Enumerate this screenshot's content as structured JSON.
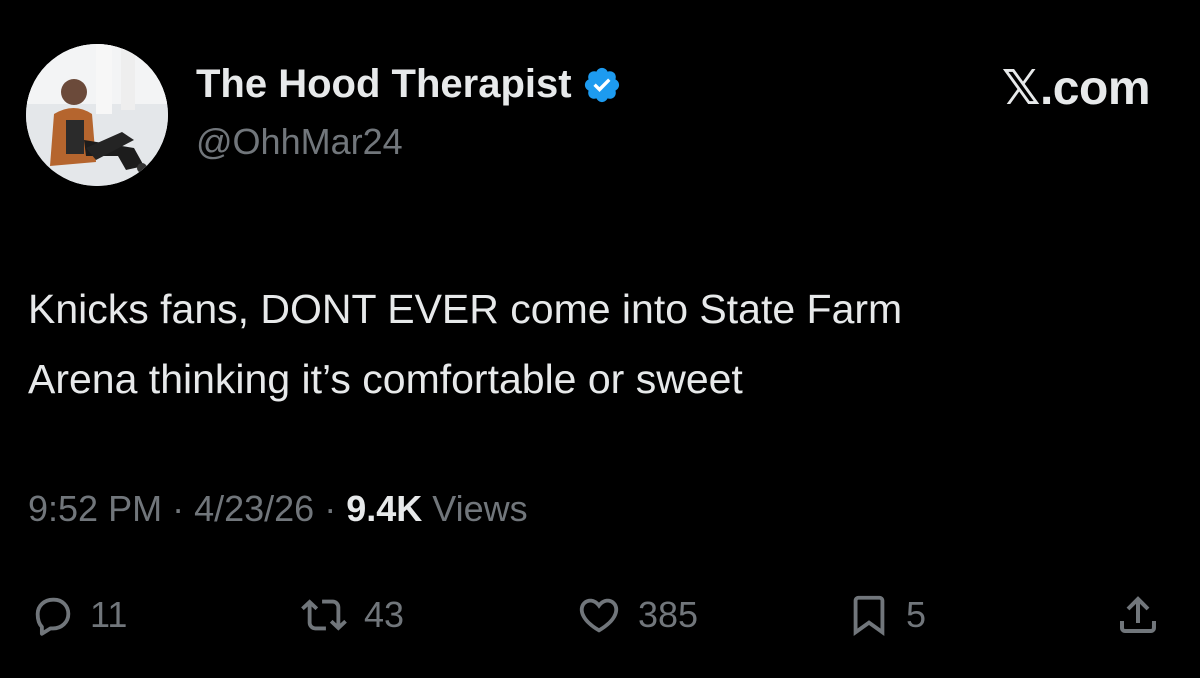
{
  "author": {
    "display_name": "The Hood Therapist",
    "handle": "@OhhMar24",
    "verified": true,
    "verified_color": "#1d9bf0"
  },
  "brand": {
    "label": "𝕏.com"
  },
  "tweet": {
    "text_line1": "Knicks fans, DONT EVER come into State Farm",
    "text_line2": "Arena thinking it’s comfortable or sweet"
  },
  "meta": {
    "time": "9:52 PM",
    "separator": " · ",
    "date": "4/23/26",
    "views_count": "9.4K",
    "views_label": " Views"
  },
  "actions": {
    "reply": {
      "icon": "reply-icon",
      "count": "11"
    },
    "repost": {
      "icon": "repost-icon",
      "count": "43"
    },
    "like": {
      "icon": "heart-icon",
      "count": "385"
    },
    "bookmark": {
      "icon": "bookmark-icon",
      "count": "5"
    },
    "share": {
      "icon": "share-icon"
    }
  },
  "colors": {
    "background": "#000000",
    "primary_text": "#e7e9ea",
    "secondary_text": "#71767b"
  }
}
